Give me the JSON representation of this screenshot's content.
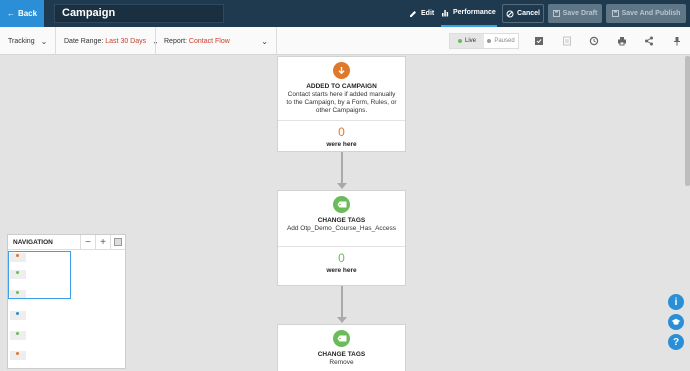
{
  "topbar": {
    "back_label": "Back",
    "campaign_title": "Campaign",
    "edit_label": "Edit",
    "performance_label": "Performance",
    "cancel_label": "Cancel",
    "save_draft_label": "Save Draft",
    "save_publish_label": "Save And Publish"
  },
  "toolbar": {
    "tracking_label": "Tracking",
    "date_range_label": "Date Range:",
    "date_range_value": "Last 30 Days",
    "report_label": "Report:",
    "report_value": "Contact Flow",
    "live_label": "Live",
    "paused_label": "Paused",
    "status_colors": {
      "live": "#6cbb5a",
      "paused": "#999999"
    }
  },
  "nodes": [
    {
      "icon": "arrow-down-circle-icon",
      "icon_color": "#e0782c",
      "title": "ADDED TO CAMPAIGN",
      "description": "Contact starts here if added manually to the Campaign, by a Form, Rules, or other Campaigns.",
      "count": "0",
      "count_label": "were here"
    },
    {
      "icon": "tag-icon",
      "icon_color": "#6cbb5a",
      "title": "CHANGE TAGS",
      "description": "Add Otp_Demo_Course_Has_Access",
      "count": "0",
      "count_label": "were here"
    },
    {
      "icon": "tag-icon",
      "icon_color": "#6cbb5a",
      "title": "CHANGE TAGS",
      "description": "Remove"
    }
  ],
  "navigation": {
    "title": "NAVIGATION",
    "zoom_out": "−",
    "zoom_in": "+"
  },
  "help": {
    "info_icon": "i",
    "courses_icon": "graduation-cap-icon",
    "question_icon": "?"
  }
}
